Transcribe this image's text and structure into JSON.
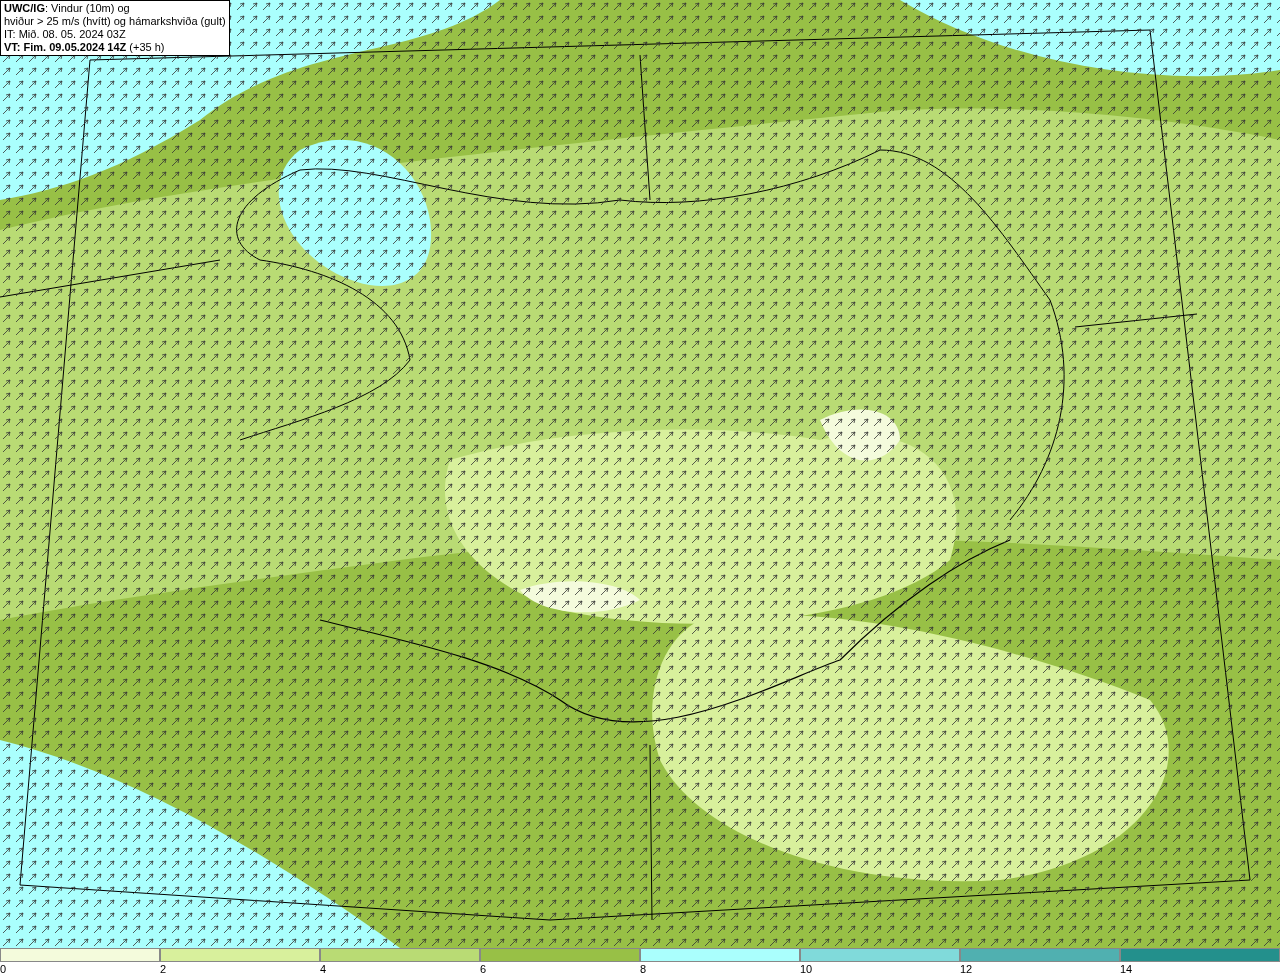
{
  "info": {
    "lines": [
      "**UWC/IG**: Vindur (10m) og",
      "hviður > 25 m/s (hvítt) og hámarkshviða (gult)",
      "IT: Mið. 08. 05. 2024 03Z",
      "**VT: Fim. 09.05.2024 14Z** (+35 h)"
    ]
  },
  "legend": {
    "bins": [
      {
        "color": "#f4fbdc",
        "label": "0"
      },
      {
        "color": "#d8f09c",
        "label": "2"
      },
      {
        "color": "#b9db74",
        "label": "4"
      },
      {
        "color": "#98c046",
        "label": "6"
      },
      {
        "color": "#aafffd",
        "label": "8"
      },
      {
        "color": "#80dada",
        "label": "10"
      },
      {
        "color": "#50b0b0",
        "label": "12"
      },
      {
        "color": "#23908c",
        "label": "14"
      }
    ]
  }
}
